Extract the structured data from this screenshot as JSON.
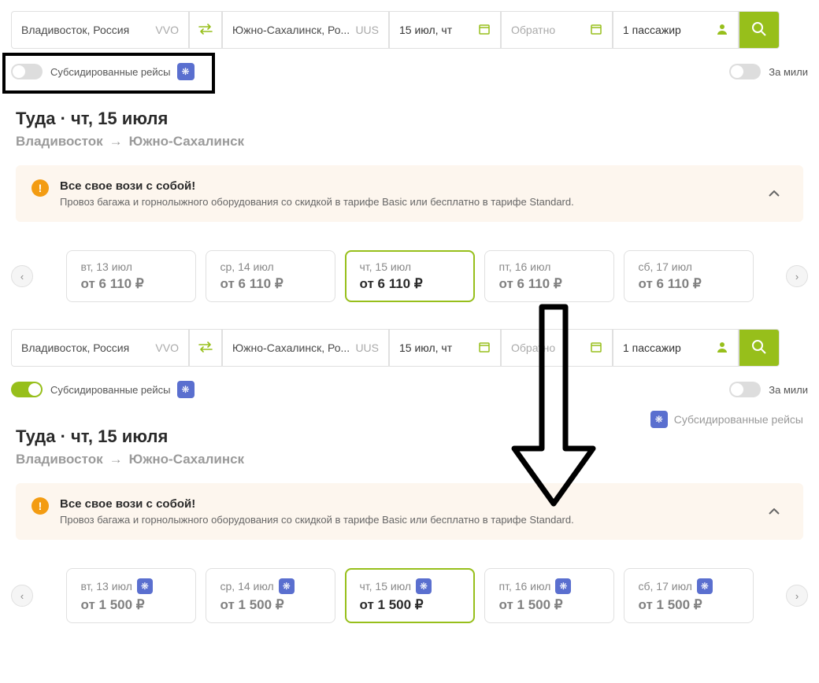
{
  "search1": {
    "from": {
      "city": "Владивосток, Россия",
      "code": "VVO"
    },
    "to": {
      "city": "Южно-Сахалинск, Ро...",
      "code": "UUS"
    },
    "date": "15 июл, чт",
    "return": "Обратно",
    "pax": "1 пассажир"
  },
  "search2": {
    "from": {
      "city": "Владивосток, Россия",
      "code": "VVO"
    },
    "to": {
      "city": "Южно-Сахалинск, Ро...",
      "code": "UUS"
    },
    "date": "15 июл, чт",
    "return": "Обратно",
    "pax": "1 пассажир"
  },
  "toggles": {
    "subsidized": "Субсидированные рейсы",
    "miles": "За мили"
  },
  "header1": {
    "title": "Туда · чт, 15 июля",
    "from": "Владивосток",
    "to": "Южно-Сахалинск"
  },
  "header2": {
    "title": "Туда · чт, 15 июля",
    "from": "Владивосток",
    "to": "Южно-Сахалинск",
    "subsidy_label": "Субсидированные рейсы"
  },
  "banner": {
    "title": "Все свое вози с собой!",
    "text": "Провоз багажа и горнолыжного оборудования со скидкой в тарифе Basic или бесплатно в тарифе Standard."
  },
  "dates1": [
    {
      "date": "вт, 13 июл",
      "price": "от 6 110 ₽"
    },
    {
      "date": "ср, 14 июл",
      "price": "от 6 110 ₽"
    },
    {
      "date": "чт, 15 июл",
      "price": "от 6 110 ₽"
    },
    {
      "date": "пт, 16 июл",
      "price": "от 6 110 ₽"
    },
    {
      "date": "сб, 17 июл",
      "price": "от 6 110 ₽"
    }
  ],
  "dates2": [
    {
      "date": "вт, 13 июл",
      "price": "от 1 500 ₽"
    },
    {
      "date": "ср, 14 июл",
      "price": "от 1 500 ₽"
    },
    {
      "date": "чт, 15 июл",
      "price": "от 1 500 ₽"
    },
    {
      "date": "пт, 16 июл",
      "price": "от 1 500 ₽"
    },
    {
      "date": "сб, 17 июл",
      "price": "от 1 500 ₽"
    }
  ]
}
